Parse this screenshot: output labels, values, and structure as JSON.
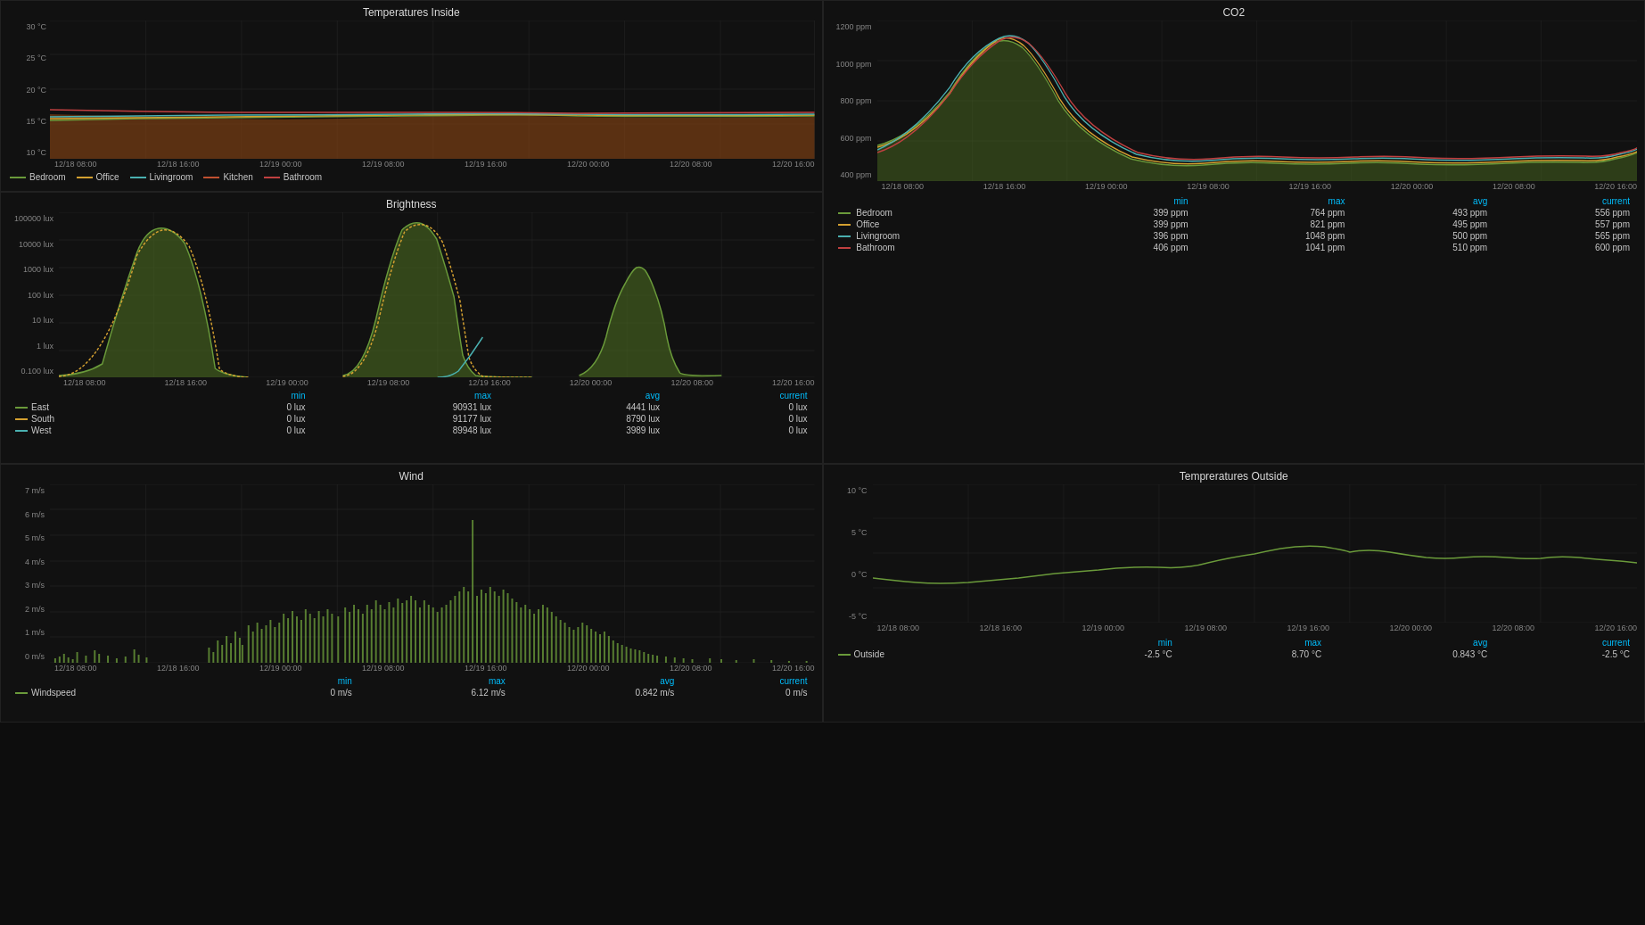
{
  "panels": {
    "temp_inside": {
      "title": "Temperatures Inside",
      "y_labels": [
        "30 °C",
        "25 °C",
        "20 °C",
        "15 °C",
        "10 °C"
      ],
      "x_labels": [
        "12/18 08:00",
        "12/18 16:00",
        "12/19 00:00",
        "12/19 08:00",
        "12/19 16:00",
        "12/20 00:00",
        "12/20 08:00",
        "12/20 16:00"
      ],
      "legend": [
        {
          "label": "Bedroom",
          "color": "#6a9a3a"
        },
        {
          "label": "Office",
          "color": "#d4a030"
        },
        {
          "label": "Livingroom",
          "color": "#4ab0b0"
        },
        {
          "label": "Kitchen",
          "color": "#c05030"
        },
        {
          "label": "Bathroom",
          "color": "#c04040"
        }
      ]
    },
    "brightness": {
      "title": "Brightness",
      "y_labels": [
        "100000 lux",
        "10000 lux",
        "1000 lux",
        "100 lux",
        "10 lux",
        "1 lux",
        "0.100 lux"
      ],
      "x_labels": [
        "12/18 08:00",
        "12/18 16:00",
        "12/19 00:00",
        "12/19 08:00",
        "12/19 16:00",
        "12/20 00:00",
        "12/20 08:00",
        "12/20 16:00"
      ],
      "legend": [
        {
          "label": "East",
          "color": "#6a9a3a"
        },
        {
          "label": "South",
          "color": "#d4a030"
        },
        {
          "label": "West",
          "color": "#4ab0b0"
        }
      ],
      "stats_headers": [
        "min",
        "max",
        "avg",
        "current"
      ],
      "stats": [
        {
          "label": "East",
          "min": "0 lux",
          "max": "90931 lux",
          "avg": "4441 lux",
          "current": "0 lux"
        },
        {
          "label": "South",
          "min": "0 lux",
          "max": "91177 lux",
          "avg": "8790 lux",
          "current": "0 lux"
        },
        {
          "label": "West",
          "min": "0 lux",
          "max": "89948 lux",
          "avg": "3989 lux",
          "current": "0 lux"
        }
      ]
    },
    "co2": {
      "title": "CO2",
      "y_labels": [
        "1200 ppm",
        "1000 ppm",
        "800 ppm",
        "600 ppm",
        "400 ppm"
      ],
      "x_labels": [
        "12/18 08:00",
        "12/18 16:00",
        "12/19 00:00",
        "12/19 08:00",
        "12/19 16:00",
        "12/20 00:00",
        "12/20 08:00",
        "12/20 16:00"
      ],
      "legend": [
        {
          "label": "Bedroom",
          "color": "#6a9a3a"
        },
        {
          "label": "Office",
          "color": "#d4a030"
        },
        {
          "label": "Livingroom",
          "color": "#4ab0b0"
        },
        {
          "label": "Bathroom",
          "color": "#c04040"
        }
      ],
      "stats_headers": [
        "min",
        "max",
        "avg",
        "current"
      ],
      "stats": [
        {
          "label": "Bedroom",
          "min": "399 ppm",
          "max": "764 ppm",
          "avg": "493 ppm",
          "current": "556 ppm"
        },
        {
          "label": "Office",
          "min": "399 ppm",
          "max": "821 ppm",
          "avg": "495 ppm",
          "current": "557 ppm"
        },
        {
          "label": "Livingroom",
          "min": "396 ppm",
          "max": "1048 ppm",
          "avg": "500 ppm",
          "current": "565 ppm"
        },
        {
          "label": "Bathroom",
          "min": "406 ppm",
          "max": "1041 ppm",
          "avg": "510 ppm",
          "current": "600 ppm"
        }
      ]
    },
    "temp_outside": {
      "title": "Tempreratures Outside",
      "y_labels": [
        "10 °C",
        "5 °C",
        "0 °C",
        "-5 °C"
      ],
      "x_labels": [
        "12/18 08:00",
        "12/18 16:00",
        "12/19 00:00",
        "12/19 08:00",
        "12/19 16:00",
        "12/20 00:00",
        "12/20 08:00",
        "12/20 16:00"
      ],
      "legend": [
        {
          "label": "Outside",
          "color": "#6a9a3a"
        }
      ],
      "stats_headers": [
        "min",
        "max",
        "avg",
        "current"
      ],
      "stats": [
        {
          "label": "Outside",
          "min": "-2.5 °C",
          "max": "8.70 °C",
          "avg": "0.843 °C",
          "current": "-2.5 °C"
        }
      ]
    },
    "wind": {
      "title": "Wind",
      "y_labels": [
        "7 m/s",
        "6 m/s",
        "5 m/s",
        "4 m/s",
        "3 m/s",
        "2 m/s",
        "1 m/s",
        "0 m/s"
      ],
      "x_labels": [
        "12/18 08:00",
        "12/18 16:00",
        "12/19 00:00",
        "12/19 08:00",
        "12/19 16:00",
        "12/20 00:00",
        "12/20 08:00",
        "12/20 16:00"
      ],
      "legend": [
        {
          "label": "Windspeed",
          "color": "#6a9a3a"
        }
      ],
      "stats_headers": [
        "min",
        "max",
        "avg",
        "current"
      ],
      "stats": [
        {
          "label": "Windspeed",
          "min": "0 m/s",
          "max": "6.12 m/s",
          "avg": "0.842 m/s",
          "current": "0 m/s"
        }
      ]
    }
  }
}
